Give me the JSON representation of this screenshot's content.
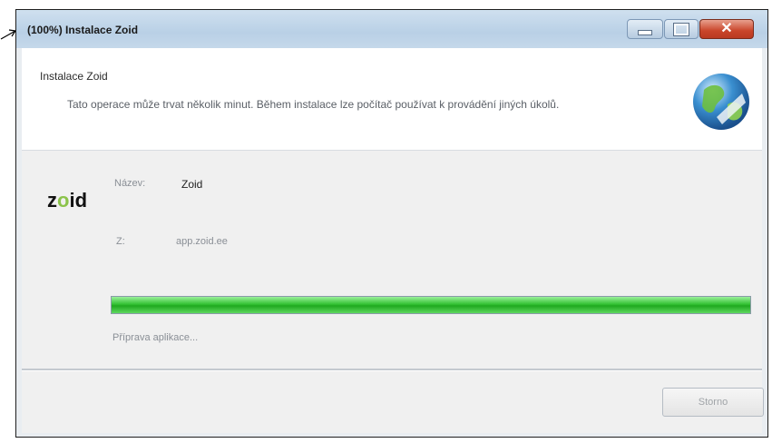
{
  "window": {
    "title": "(100%) Instalace Zoid"
  },
  "header": {
    "title": "Instalace Zoid",
    "description": "Tato operace může trvat několik minut. Během instalace lze počítač používat k provádění jiných úkolů.",
    "icon": "globe-install-icon"
  },
  "app": {
    "logo_text": "zoid",
    "name_label": "Název:",
    "name_value": "Zoid",
    "source_label": "Z:",
    "source_value": "app.zoid.ee"
  },
  "progress": {
    "value_percent": 100,
    "status": "Příprava aplikace..."
  },
  "footer": {
    "button_label": "Storno"
  },
  "colors": {
    "progress_green": "#2bbd2b",
    "close_red": "#c9452a",
    "titlebar_blue": "#c3d7ea"
  }
}
